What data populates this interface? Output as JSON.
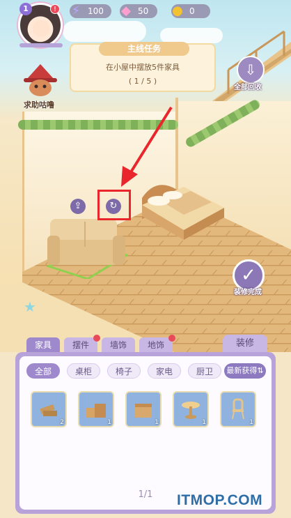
{
  "player": {
    "level": "1",
    "alert": "!"
  },
  "resources": {
    "energy": "100",
    "gems": "50",
    "coins": "0"
  },
  "quest": {
    "title": "主线任务",
    "description": "在小屋中摆放5件家具",
    "progress": "( 1 / 5 )"
  },
  "helper": {
    "label": "求助咕噜"
  },
  "buttons": {
    "recycle_all": "全部回收",
    "finish_decorating": "装修完成",
    "decorate": "装修"
  },
  "tabs": [
    {
      "label": "家具",
      "active": true,
      "dot": false
    },
    {
      "label": "摆件",
      "active": false,
      "dot": true
    },
    {
      "label": "墙饰",
      "active": false,
      "dot": false
    },
    {
      "label": "地饰",
      "active": false,
      "dot": true
    }
  ],
  "filters": [
    {
      "label": "全部",
      "active": true
    },
    {
      "label": "桌柜",
      "active": false
    },
    {
      "label": "椅子",
      "active": false
    },
    {
      "label": "家电",
      "active": false
    },
    {
      "label": "厨卫",
      "active": false
    }
  ],
  "newest_label": "最新获得⇅",
  "items": [
    {
      "icon": "wood-planks-icon",
      "count": "2"
    },
    {
      "icon": "crates-icon",
      "count": "1"
    },
    {
      "icon": "box-icon",
      "count": "1"
    },
    {
      "icon": "round-table-icon",
      "count": "1"
    },
    {
      "icon": "chair-icon",
      "count": "1"
    }
  ],
  "pager": "1/1",
  "watermark": "ITMOP.COM",
  "colors": {
    "accent_purple": "#9f89cd",
    "highlight_red": "#e8262c",
    "alert_red": "#e94b5a"
  }
}
